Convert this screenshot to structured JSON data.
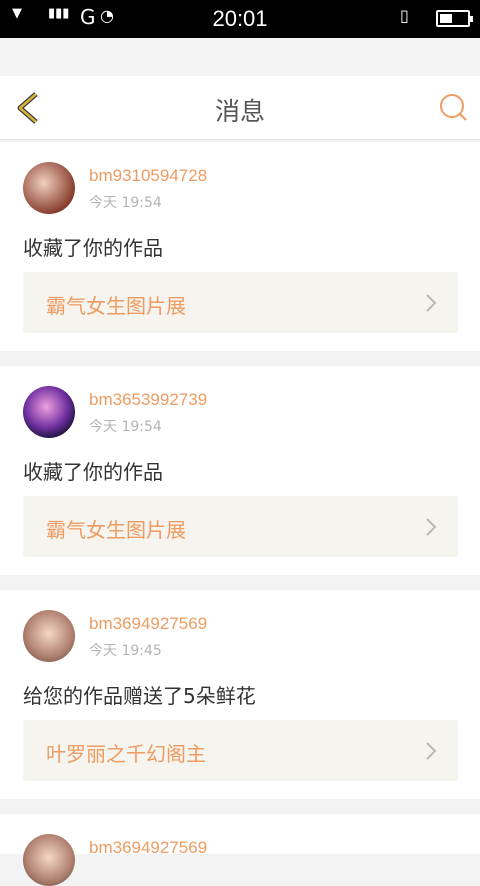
{
  "status": {
    "time": "20:01",
    "network": "G"
  },
  "header": {
    "title": "消息"
  },
  "messages": [
    {
      "user": "bm9310594728",
      "time": "今天 19:54",
      "text": "收藏了你的作品",
      "work": "霸气女生图片展"
    },
    {
      "user": "bm3653992739",
      "time": "今天 19:54",
      "text": "收藏了你的作品",
      "work": "霸气女生图片展"
    },
    {
      "user": "bm3694927569",
      "time": "今天 19:45",
      "text": "给您的作品赠送了5朵鲜花",
      "work": "叶罗丽之千幻阁主"
    },
    {
      "user": "bm3694927569"
    }
  ],
  "colors": {
    "accent": "#ee9b62",
    "back": "#d5b53a"
  }
}
